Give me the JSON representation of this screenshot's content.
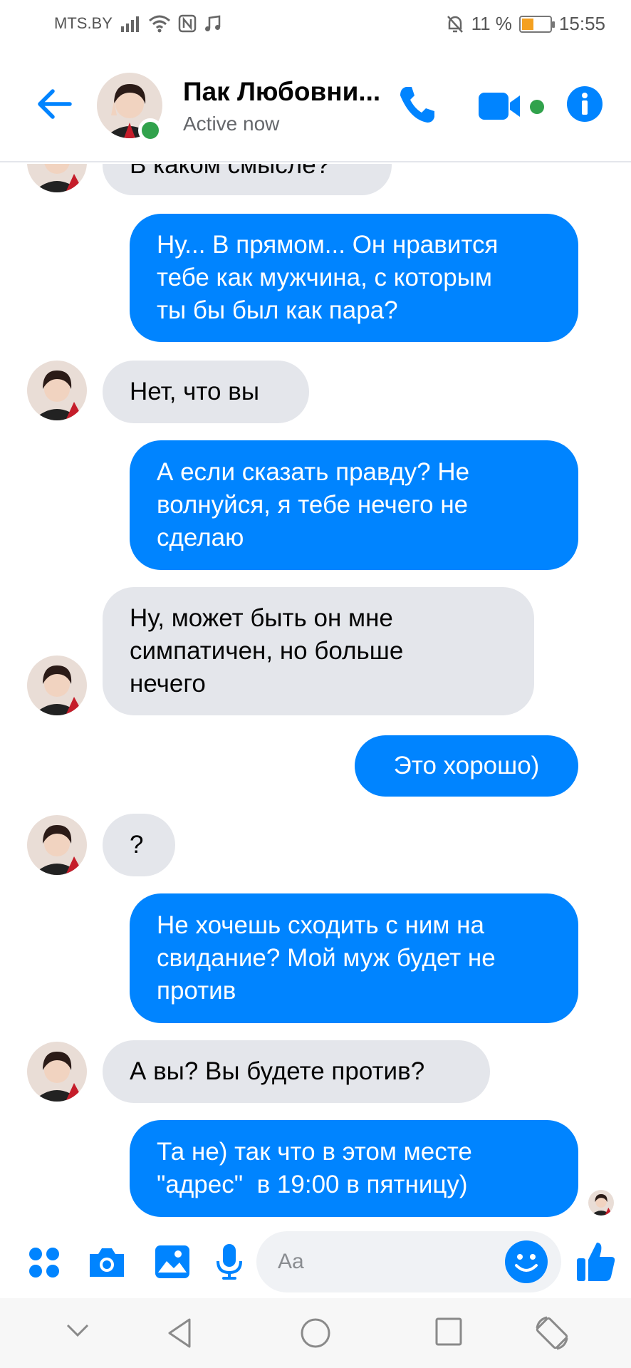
{
  "status_bar": {
    "carrier": "MTS.BY",
    "battery_percent": "11 %",
    "battery_level": 0.11,
    "time": "15:55"
  },
  "header": {
    "contact_name": "Пак Любовни...",
    "status": "Active now",
    "icons": [
      "back-arrow-icon",
      "phone-icon",
      "video-camera-icon",
      "info-icon"
    ]
  },
  "messages": [
    {
      "side": "in",
      "lines": [
        "В каком смысле?"
      ],
      "show_avatar": true
    },
    {
      "side": "out",
      "lines": [
        "Ну... В прямом... Он нравится",
        "тебе как мужчина, с которым",
        "ты бы был как пара?"
      ]
    },
    {
      "side": "in",
      "lines": [
        "Нет, что вы"
      ],
      "show_avatar": true
    },
    {
      "side": "out",
      "lines": [
        "А если сказать правду? Не",
        "волнуйся, я тебе нечего не",
        "сделаю"
      ]
    },
    {
      "side": "in",
      "lines": [
        "Ну, может быть он мне",
        "симпатичен, но больше",
        "нечего"
      ],
      "show_avatar": true
    },
    {
      "side": "out",
      "lines": [
        "Это хорошо)"
      ]
    },
    {
      "side": "in",
      "lines": [
        "?"
      ],
      "show_avatar": true
    },
    {
      "side": "out",
      "lines": [
        "Не хочешь сходить с ним на",
        "свидание? Мой муж будет не",
        "против"
      ]
    },
    {
      "side": "in",
      "lines": [
        "А вы? Вы будете против?"
      ],
      "show_avatar": true
    },
    {
      "side": "out",
      "lines": [
        "Та не) так что в этом месте",
        "\"адрес\"  в 19:00 в пятницу)"
      ],
      "read_receipt": true
    }
  ],
  "composer": {
    "placeholder": "Aa",
    "icons": [
      "apps-grid-icon",
      "camera-icon",
      "gallery-icon",
      "microphone-icon",
      "emoji-icon",
      "thumbs-up-icon"
    ]
  },
  "colors": {
    "accent": "#0084ff",
    "incoming_bubble": "#e4e6eb",
    "online": "#31a24c"
  }
}
